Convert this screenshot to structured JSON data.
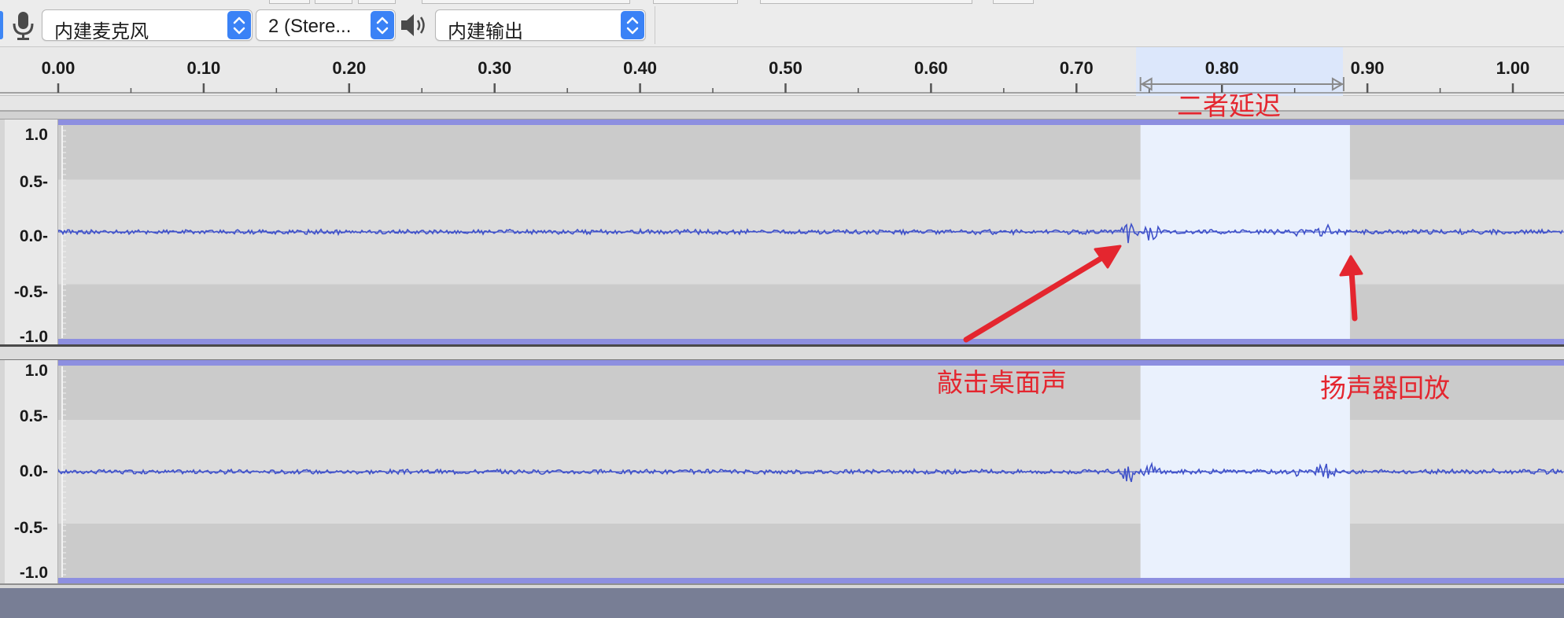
{
  "toolbar": {
    "input_device": "内建麦克风",
    "channels": "2 (Stere...",
    "output_device": "内建输出",
    "icons": [
      "microphone-icon",
      "speaker-icon",
      "updown-stepper-icon"
    ]
  },
  "ruler": {
    "ticks": [
      "0.00",
      "0.10",
      "0.20",
      "0.30",
      "0.40",
      "0.50",
      "0.60",
      "0.70",
      "0.80",
      "0.90",
      "1.00"
    ]
  },
  "tracks": [
    {
      "scale_labels": [
        "1.0",
        "0.5-",
        "0.0-",
        "-0.5-",
        "-1.0"
      ]
    },
    {
      "scale_labels": [
        "1.0",
        "0.5-",
        "0.0-",
        "-0.5-",
        "-1.0"
      ]
    }
  ],
  "selection": {
    "start_seconds": 0.744,
    "end_seconds": 0.888
  },
  "annotations": {
    "delay_label": "二者延迟",
    "tap_label": "敲击桌面声",
    "playback_label": "扬声器回放",
    "color": "#e4262f"
  },
  "colors": {
    "waveform": "#3f51c9",
    "track_background": "#cbcbcb",
    "track_band": "#dcdcdc",
    "selection_track": "#eaf1fd",
    "selection_ruler": "#dce7fb",
    "accent": "#3a82f6"
  }
}
